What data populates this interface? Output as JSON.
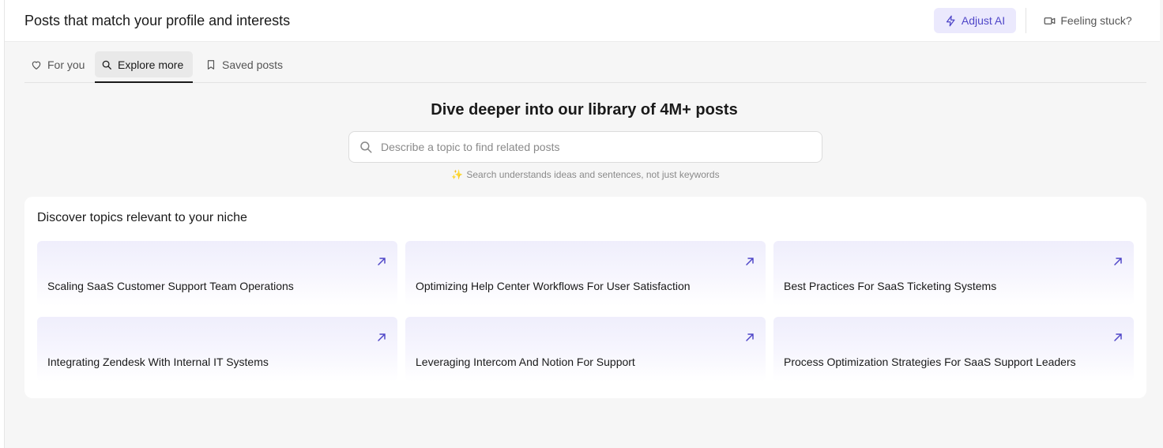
{
  "header": {
    "title": "Posts that match your profile and interests",
    "adjust_label": "Adjust AI",
    "stuck_label": "Feeling stuck?"
  },
  "tabs": [
    {
      "label": "For you",
      "icon": "heart-icon",
      "active": false
    },
    {
      "label": "Explore more",
      "icon": "search-icon",
      "active": true
    },
    {
      "label": "Saved posts",
      "icon": "bookmark-icon",
      "active": false
    }
  ],
  "explore": {
    "title": "Dive deeper into our library of 4M+ posts",
    "search_placeholder": "Describe a topic to find related posts",
    "search_value": "",
    "hint": "Search understands ideas and sentences, not just keywords"
  },
  "topics": {
    "title": "Discover topics relevant to your niche",
    "items": [
      {
        "label": "Scaling SaaS Customer Support Team Operations"
      },
      {
        "label": "Optimizing Help Center Workflows For User Satisfaction"
      },
      {
        "label": "Best Practices For SaaS Ticketing Systems"
      },
      {
        "label": "Integrating Zendesk With Internal IT Systems"
      },
      {
        "label": "Leveraging Intercom And Notion For Support"
      },
      {
        "label": "Process Optimization Strategies For SaaS Support Leaders"
      }
    ]
  },
  "colors": {
    "accent": "#4f46c8",
    "accent_bg": "#ebe9fd",
    "page_bg": "#f6f6f6"
  }
}
